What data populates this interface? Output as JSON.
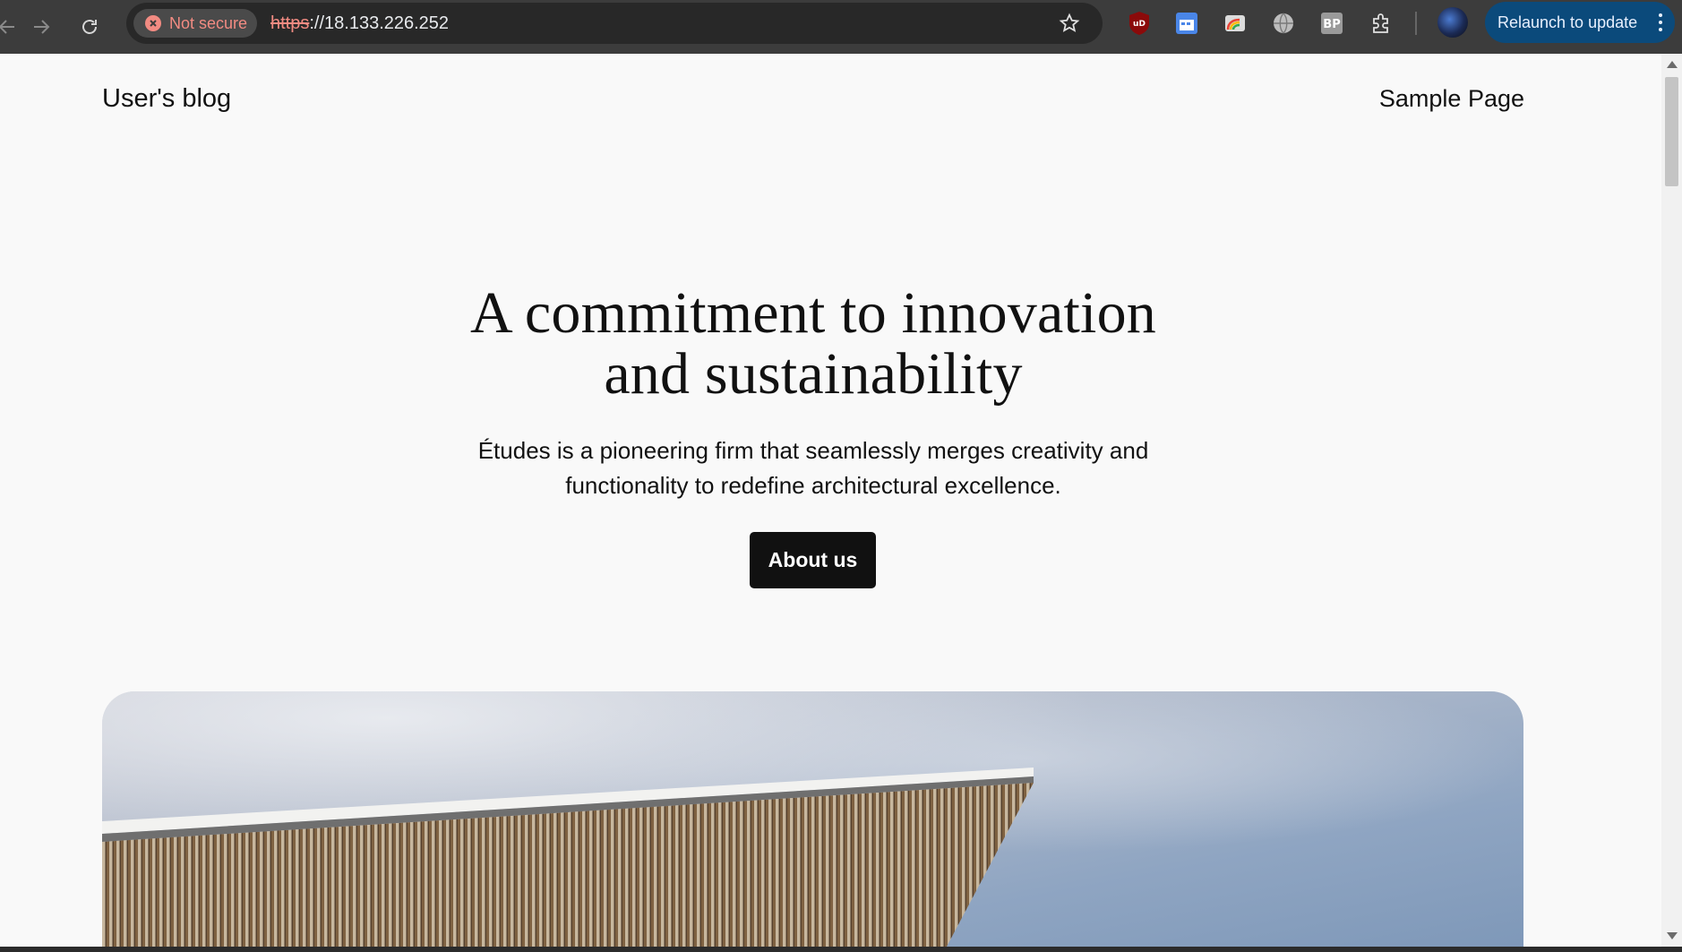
{
  "browser": {
    "security_label": "Not secure",
    "url_scheme": "https",
    "url_rest": "://18.133.226.252",
    "relaunch_label": "Relaunch to update",
    "extensions": [
      "ublock-origin-icon",
      "calendar-extension-icon",
      "rainbow-card-icon",
      "globe-icon",
      "bp-extension-icon",
      "extensions-puzzle-icon"
    ],
    "bp_label": "BP",
    "ud_label": "uD",
    "accent_color": "#0b4a7b",
    "warning_color": "#f28b82"
  },
  "site": {
    "title": "User's blog",
    "nav": {
      "sample_page": "Sample Page"
    }
  },
  "hero": {
    "heading_line1": "A commitment to innovation",
    "heading_line2": "and sustainability",
    "text_line1": "Études is a pioneering firm that seamlessly merges creativity and",
    "text_line2": "functionality to redefine architectural excellence.",
    "cta_label": "About us"
  }
}
